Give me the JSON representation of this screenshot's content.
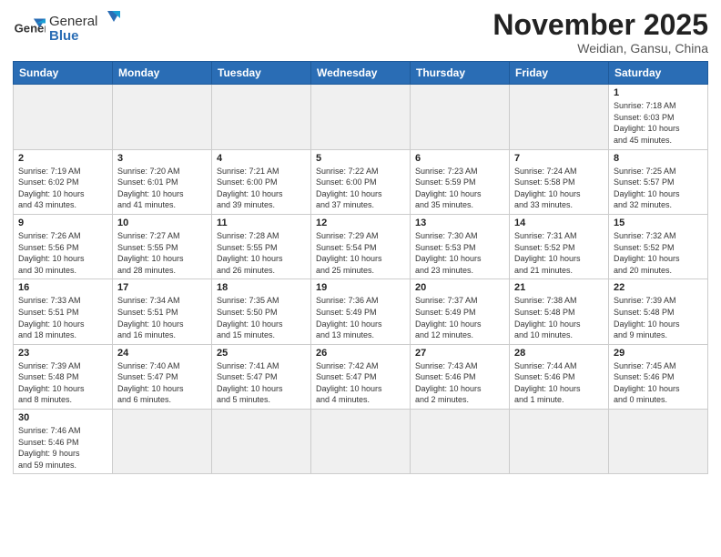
{
  "header": {
    "logo_general": "General",
    "logo_blue": "Blue",
    "month_title": "November 2025",
    "location": "Weidian, Gansu, China"
  },
  "days_of_week": [
    "Sunday",
    "Monday",
    "Tuesday",
    "Wednesday",
    "Thursday",
    "Friday",
    "Saturday"
  ],
  "weeks": [
    [
      {
        "day": "",
        "info": ""
      },
      {
        "day": "",
        "info": ""
      },
      {
        "day": "",
        "info": ""
      },
      {
        "day": "",
        "info": ""
      },
      {
        "day": "",
        "info": ""
      },
      {
        "day": "",
        "info": ""
      },
      {
        "day": "1",
        "info": "Sunrise: 7:18 AM\nSunset: 6:03 PM\nDaylight: 10 hours\nand 45 minutes."
      }
    ],
    [
      {
        "day": "2",
        "info": "Sunrise: 7:19 AM\nSunset: 6:02 PM\nDaylight: 10 hours\nand 43 minutes."
      },
      {
        "day": "3",
        "info": "Sunrise: 7:20 AM\nSunset: 6:01 PM\nDaylight: 10 hours\nand 41 minutes."
      },
      {
        "day": "4",
        "info": "Sunrise: 7:21 AM\nSunset: 6:00 PM\nDaylight: 10 hours\nand 39 minutes."
      },
      {
        "day": "5",
        "info": "Sunrise: 7:22 AM\nSunset: 6:00 PM\nDaylight: 10 hours\nand 37 minutes."
      },
      {
        "day": "6",
        "info": "Sunrise: 7:23 AM\nSunset: 5:59 PM\nDaylight: 10 hours\nand 35 minutes."
      },
      {
        "day": "7",
        "info": "Sunrise: 7:24 AM\nSunset: 5:58 PM\nDaylight: 10 hours\nand 33 minutes."
      },
      {
        "day": "8",
        "info": "Sunrise: 7:25 AM\nSunset: 5:57 PM\nDaylight: 10 hours\nand 32 minutes."
      }
    ],
    [
      {
        "day": "9",
        "info": "Sunrise: 7:26 AM\nSunset: 5:56 PM\nDaylight: 10 hours\nand 30 minutes."
      },
      {
        "day": "10",
        "info": "Sunrise: 7:27 AM\nSunset: 5:55 PM\nDaylight: 10 hours\nand 28 minutes."
      },
      {
        "day": "11",
        "info": "Sunrise: 7:28 AM\nSunset: 5:55 PM\nDaylight: 10 hours\nand 26 minutes."
      },
      {
        "day": "12",
        "info": "Sunrise: 7:29 AM\nSunset: 5:54 PM\nDaylight: 10 hours\nand 25 minutes."
      },
      {
        "day": "13",
        "info": "Sunrise: 7:30 AM\nSunset: 5:53 PM\nDaylight: 10 hours\nand 23 minutes."
      },
      {
        "day": "14",
        "info": "Sunrise: 7:31 AM\nSunset: 5:52 PM\nDaylight: 10 hours\nand 21 minutes."
      },
      {
        "day": "15",
        "info": "Sunrise: 7:32 AM\nSunset: 5:52 PM\nDaylight: 10 hours\nand 20 minutes."
      }
    ],
    [
      {
        "day": "16",
        "info": "Sunrise: 7:33 AM\nSunset: 5:51 PM\nDaylight: 10 hours\nand 18 minutes."
      },
      {
        "day": "17",
        "info": "Sunrise: 7:34 AM\nSunset: 5:51 PM\nDaylight: 10 hours\nand 16 minutes."
      },
      {
        "day": "18",
        "info": "Sunrise: 7:35 AM\nSunset: 5:50 PM\nDaylight: 10 hours\nand 15 minutes."
      },
      {
        "day": "19",
        "info": "Sunrise: 7:36 AM\nSunset: 5:49 PM\nDaylight: 10 hours\nand 13 minutes."
      },
      {
        "day": "20",
        "info": "Sunrise: 7:37 AM\nSunset: 5:49 PM\nDaylight: 10 hours\nand 12 minutes."
      },
      {
        "day": "21",
        "info": "Sunrise: 7:38 AM\nSunset: 5:48 PM\nDaylight: 10 hours\nand 10 minutes."
      },
      {
        "day": "22",
        "info": "Sunrise: 7:39 AM\nSunset: 5:48 PM\nDaylight: 10 hours\nand 9 minutes."
      }
    ],
    [
      {
        "day": "23",
        "info": "Sunrise: 7:39 AM\nSunset: 5:48 PM\nDaylight: 10 hours\nand 8 minutes."
      },
      {
        "day": "24",
        "info": "Sunrise: 7:40 AM\nSunset: 5:47 PM\nDaylight: 10 hours\nand 6 minutes."
      },
      {
        "day": "25",
        "info": "Sunrise: 7:41 AM\nSunset: 5:47 PM\nDaylight: 10 hours\nand 5 minutes."
      },
      {
        "day": "26",
        "info": "Sunrise: 7:42 AM\nSunset: 5:47 PM\nDaylight: 10 hours\nand 4 minutes."
      },
      {
        "day": "27",
        "info": "Sunrise: 7:43 AM\nSunset: 5:46 PM\nDaylight: 10 hours\nand 2 minutes."
      },
      {
        "day": "28",
        "info": "Sunrise: 7:44 AM\nSunset: 5:46 PM\nDaylight: 10 hours\nand 1 minute."
      },
      {
        "day": "29",
        "info": "Sunrise: 7:45 AM\nSunset: 5:46 PM\nDaylight: 10 hours\nand 0 minutes."
      }
    ],
    [
      {
        "day": "30",
        "info": "Sunrise: 7:46 AM\nSunset: 5:46 PM\nDaylight: 9 hours\nand 59 minutes."
      },
      {
        "day": "",
        "info": ""
      },
      {
        "day": "",
        "info": ""
      },
      {
        "day": "",
        "info": ""
      },
      {
        "day": "",
        "info": ""
      },
      {
        "day": "",
        "info": ""
      },
      {
        "day": "",
        "info": ""
      }
    ]
  ]
}
